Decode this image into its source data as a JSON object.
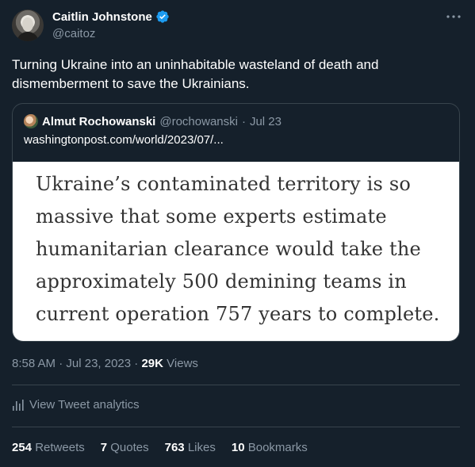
{
  "author": {
    "name": "Caitlin Johnstone",
    "handle": "@caitoz",
    "verified": true
  },
  "tweet_text": "Turning Ukraine into an uninhabitable wasteland of death and dismemberment to save the Ukrainians.",
  "quote": {
    "name": "Almut Rochowanski",
    "handle": "@rochowanski",
    "separator": "·",
    "date": "Jul 23",
    "link": "washingtonpost.com/world/2023/07/...",
    "image_text": "Ukraine’s contaminated territory is so massive that some experts estimate humanitarian clearance would take the approximately 500 demining teams in current operation 757 years to complete."
  },
  "meta": {
    "time": "8:58 AM",
    "sep1": "·",
    "date": "Jul 23, 2023",
    "sep2": "·",
    "views": "29K",
    "views_label": "Views"
  },
  "analytics": {
    "label": "View Tweet analytics",
    "icon": "bar-chart-icon"
  },
  "stats": [
    {
      "value": "254",
      "label": "Retweets"
    },
    {
      "value": "7",
      "label": "Quotes"
    },
    {
      "value": "763",
      "label": "Likes"
    },
    {
      "value": "10",
      "label": "Bookmarks"
    }
  ],
  "colors": {
    "background": "#15202b",
    "secondary_text": "#8b98a5",
    "border": "#38444d",
    "verified_blue": "#1d9bf0"
  }
}
